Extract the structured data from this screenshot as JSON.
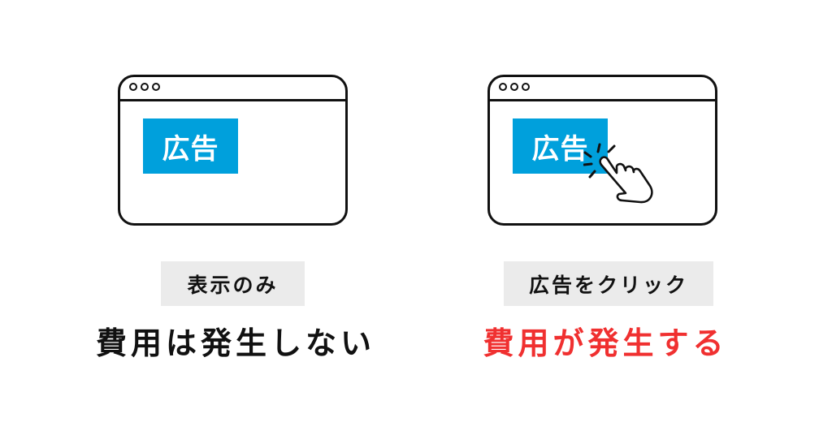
{
  "colors": {
    "ad_background": "#00a0dc",
    "label_background": "#ebebeb",
    "result_neutral": "#111111",
    "result_cost": "#f03030"
  },
  "left_panel": {
    "ad_label": "広告",
    "condition": "表示のみ",
    "result": "費用は発生しない"
  },
  "right_panel": {
    "ad_label": "広告",
    "condition": "広告をクリック",
    "result": "費用が発生する",
    "cursor_icon": "pointing-hand-click-icon"
  }
}
